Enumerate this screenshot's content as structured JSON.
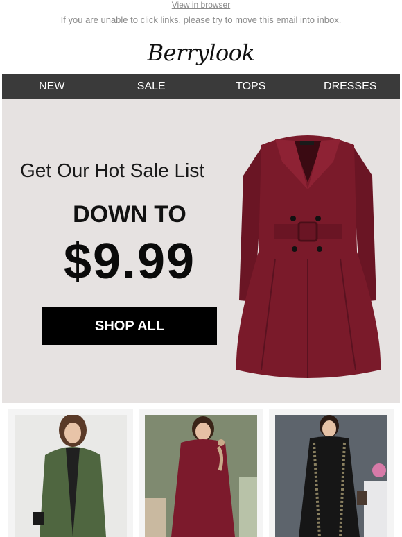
{
  "header": {
    "view_in_browser": "View in browser",
    "notice": "If you are unable to click links, please try to move this email into inbox.",
    "logo": "Berrylook"
  },
  "nav": {
    "items": [
      {
        "label": "NEW"
      },
      {
        "label": "SALE"
      },
      {
        "label": "TOPS"
      },
      {
        "label": "DRESSES"
      }
    ]
  },
  "hero": {
    "subtitle": "Get Our Hot Sale List",
    "down_to": "DOWN TO",
    "price": "$9.99",
    "button": "SHOP ALL",
    "coat_color": "#7a1a2a",
    "background": "#e6e2e1"
  },
  "products": [
    {
      "color": "#4f6640",
      "icon": "green-coat-photo"
    },
    {
      "color": "#7c1a2c",
      "icon": "burgundy-dress-photo"
    },
    {
      "color": "#1c1c1c",
      "icon": "black-lace-dress-photo"
    }
  ]
}
